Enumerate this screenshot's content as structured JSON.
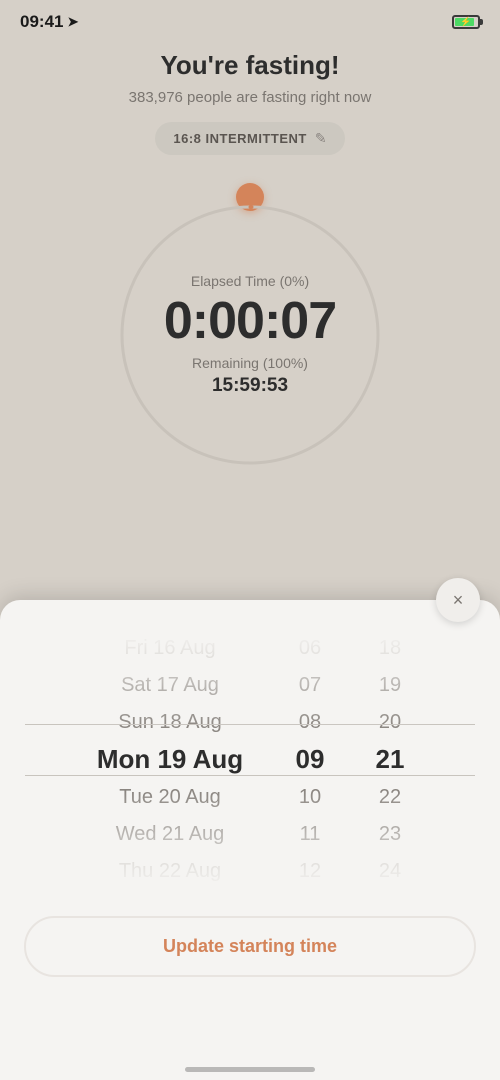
{
  "statusBar": {
    "time": "09:41",
    "locationIcon": "➤"
  },
  "header": {
    "title": "You're fasting!",
    "subtitle": "383,976 people are fasting right now",
    "plan": {
      "label": "16:8 INTERMITTENT",
      "editIcon": "✎"
    }
  },
  "timer": {
    "elapsedLabel": "Elapsed Time (0%)",
    "elapsedTime": "0:00:07",
    "remainingLabel": "Remaining (100%)",
    "remainingTime": "15:59:53"
  },
  "picker": {
    "dates": [
      {
        "text": "Fri 16 Aug",
        "state": "far"
      },
      {
        "text": "Sat 17 Aug",
        "state": "near-far"
      },
      {
        "text": "Sun 18 Aug",
        "state": "near"
      },
      {
        "text": "Mon 19 Aug",
        "state": "selected"
      },
      {
        "text": "Tue 20 Aug",
        "state": "near"
      },
      {
        "text": "Wed 21 Aug",
        "state": "near-far"
      },
      {
        "text": "Thu 22 Aug",
        "state": "far"
      }
    ],
    "hours": [
      {
        "text": "06",
        "state": "far"
      },
      {
        "text": "07",
        "state": "near-far"
      },
      {
        "text": "08",
        "state": "near"
      },
      {
        "text": "09",
        "state": "selected"
      },
      {
        "text": "10",
        "state": "near"
      },
      {
        "text": "11",
        "state": "near-far"
      },
      {
        "text": "12",
        "state": "far"
      }
    ],
    "minutes": [
      {
        "text": "18",
        "state": "far"
      },
      {
        "text": "19",
        "state": "near-far"
      },
      {
        "text": "20",
        "state": "near"
      },
      {
        "text": "21",
        "state": "selected"
      },
      {
        "text": "22",
        "state": "near"
      },
      {
        "text": "23",
        "state": "near-far"
      },
      {
        "text": "24",
        "state": "far"
      }
    ]
  },
  "updateButton": {
    "label": "Update starting time"
  },
  "closeButton": {
    "label": "×"
  }
}
